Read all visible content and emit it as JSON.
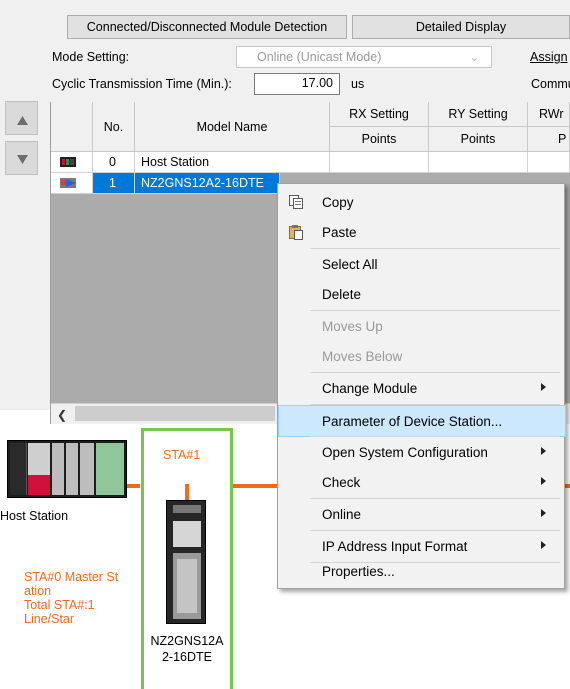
{
  "toolbar": {
    "detection_button": "Connected/Disconnected Module Detection",
    "detailed_display_button": "Detailed Display"
  },
  "settings": {
    "mode_label": "Mode Setting:",
    "mode_value": "Online (Unicast Mode)",
    "assign_label": "Assign",
    "cyclic_label": "Cyclic Transmission Time (Min.):",
    "cyclic_value": "17.00",
    "cyclic_unit": "us",
    "commu_label": "Commu"
  },
  "grid": {
    "headers": {
      "no": "No.",
      "model": "Model Name",
      "rx": "RX Setting",
      "ry": "RY Setting",
      "rwr": "RWr",
      "points": "Points",
      "points_partial": "P"
    },
    "rows": [
      {
        "no": "0",
        "model": "Host Station",
        "selected": false
      },
      {
        "no": "1",
        "model": "NZ2GNS12A2-16DTE",
        "selected": true
      }
    ]
  },
  "context_menu": {
    "items": [
      {
        "label": "Copy",
        "icon": "copy-icon",
        "enabled": true
      },
      {
        "label": "Paste",
        "icon": "paste-icon",
        "enabled": true
      },
      {
        "label": "Select All",
        "enabled": true
      },
      {
        "label": "Delete",
        "enabled": true
      },
      {
        "label": "Moves Up",
        "enabled": false
      },
      {
        "label": "Moves Below",
        "enabled": false
      },
      {
        "label": "Change Module",
        "enabled": true,
        "submenu": true
      },
      {
        "label": "Parameter of Device Station...",
        "enabled": true,
        "highlighted": true
      },
      {
        "label": "Open System Configuration",
        "enabled": true,
        "submenu": true
      },
      {
        "label": "Check",
        "enabled": true,
        "submenu": true
      },
      {
        "label": "Online",
        "enabled": true,
        "submenu": true
      },
      {
        "label": "IP Address Input Format",
        "enabled": true,
        "submenu": true
      },
      {
        "label": "Properties...",
        "enabled": true
      }
    ]
  },
  "diagram": {
    "host_label": "Host Station",
    "sta_label": "STA#1",
    "master_info": "STA#0  Master St\nation\nTotal STA#:1\nLine/Star",
    "device_label": "NZ2GNS12A\n2-16DTE"
  },
  "colors": {
    "selection_blue": "#0078d7",
    "menu_highlight": "#cce8ff",
    "accent_orange": "#f26a1b",
    "frame_green": "#74c84b"
  }
}
